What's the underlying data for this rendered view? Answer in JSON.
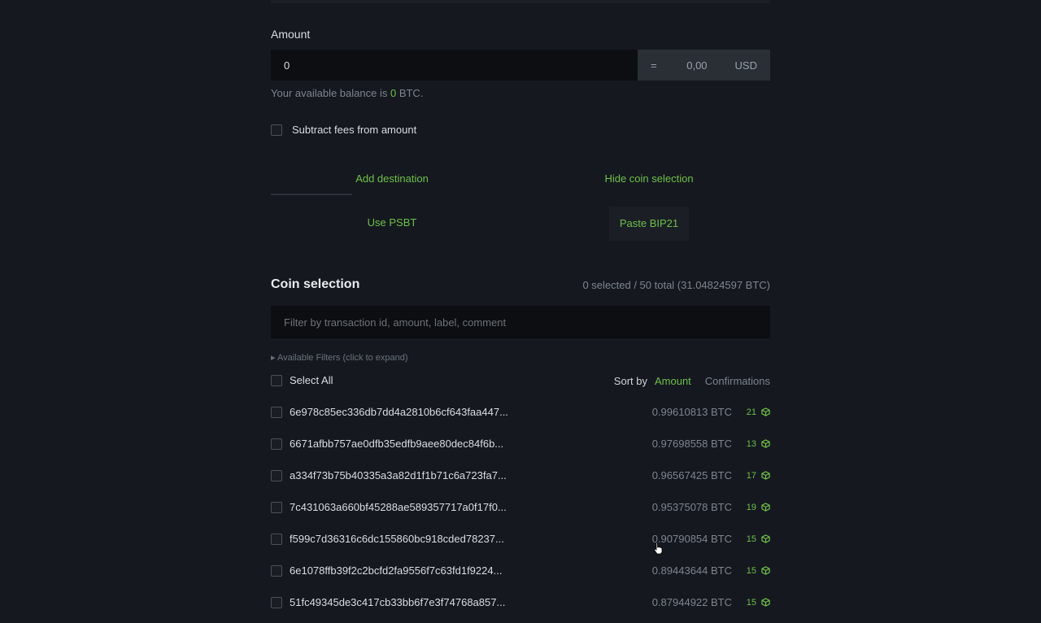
{
  "amount": {
    "label": "Amount",
    "value": "0",
    "fiat_eq": "=",
    "fiat_value": "0,00",
    "fiat_currency": "USD"
  },
  "balance": {
    "prefix": "Your available balance is ",
    "value": "0",
    "suffix": " BTC."
  },
  "subtract_fees": {
    "label": "Subtract fees from amount"
  },
  "actions": {
    "add_destination": "Add destination",
    "hide_coin_selection": "Hide coin selection",
    "use_psbt": "Use PSBT",
    "paste_bip21": "Paste BIP21"
  },
  "coin_selection": {
    "title": "Coin selection",
    "summary": "0 selected / 50 total (31.04824597 BTC)",
    "filter_placeholder": "Filter by transaction id, amount, label, comment",
    "filters_toggle": "▸ Available Filters (click to expand)",
    "select_all": "Select All",
    "sort_label": "Sort by",
    "sort_amount": "Amount",
    "sort_confirmations": "Confirmations",
    "coins": [
      {
        "txid": "6e978c85ec336db7dd4a2810b6cf643faa447...",
        "amount": "0.99610813 BTC",
        "conf": "21"
      },
      {
        "txid": "6671afbb757ae0dfb35edfb9aee80dec84f6b...",
        "amount": "0.97698558 BTC",
        "conf": "13"
      },
      {
        "txid": "a334f73b75b40335a3a82d1f1b71c6a723fa7...",
        "amount": "0.96567425 BTC",
        "conf": "17"
      },
      {
        "txid": "7c431063a660bf45288ae589357717a0f17f0...",
        "amount": "0.95375078 BTC",
        "conf": "19"
      },
      {
        "txid": "f599c7d36316c6dc155860bc918cded78237...",
        "amount": "0.90790854 BTC",
        "conf": "15"
      },
      {
        "txid": "6e1078ffb39f2c2bcfd2fa9556f7c63fd1f9224...",
        "amount": "0.89443644 BTC",
        "conf": "15"
      },
      {
        "txid": "51fc49345de3c417cb33bb6f7e3f74768a857...",
        "amount": "0.87944922 BTC",
        "conf": "15"
      }
    ]
  },
  "colors": {
    "accent": "#6fbf4a",
    "background": "#15191f"
  }
}
